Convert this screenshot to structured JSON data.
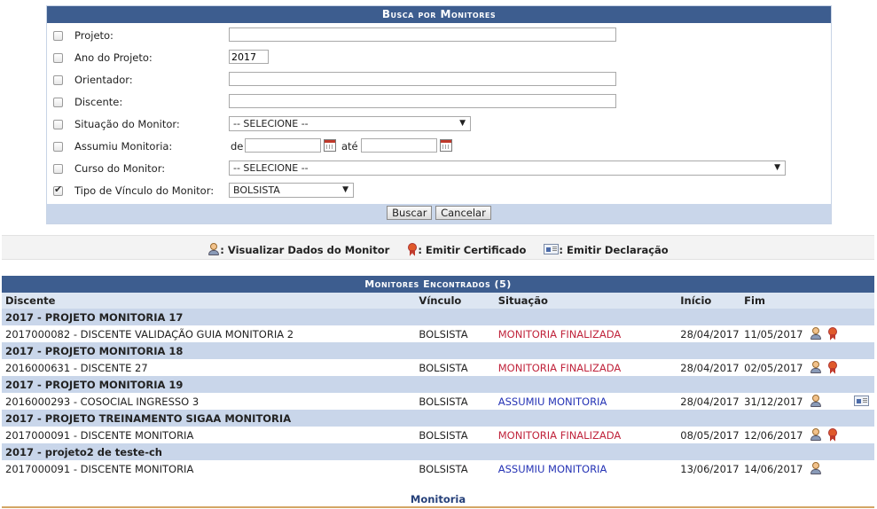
{
  "search": {
    "title": "Busca por Monitores",
    "fields": {
      "projeto": {
        "label": "Projeto:",
        "value": ""
      },
      "ano": {
        "label": "Ano do Projeto:",
        "value": "2017"
      },
      "orientador": {
        "label": "Orientador:",
        "value": ""
      },
      "discente": {
        "label": "Discente:",
        "value": ""
      },
      "situacao": {
        "label": "Situação do Monitor:",
        "value": "-- SELECIONE --"
      },
      "assumiu": {
        "label": "Assumiu Monitoria:",
        "de": "de",
        "ate": "até",
        "from": "",
        "to": ""
      },
      "curso": {
        "label": "Curso do Monitor:",
        "value": "-- SELECIONE --"
      },
      "vinculo": {
        "label": "Tipo de Vínculo do Monitor:",
        "value": "BOLSISTA"
      }
    },
    "buttons": {
      "buscar": "Buscar",
      "cancelar": "Cancelar"
    }
  },
  "legend": {
    "visualizar": ": Visualizar Dados do Monitor",
    "certificado": ": Emitir Certificado",
    "declaracao": ": Emitir Declaração"
  },
  "results": {
    "title": "Monitores Encontrados (5)",
    "headers": {
      "discente": "Discente",
      "vinculo": "Vínculo",
      "situacao": "Situação",
      "inicio": "Início",
      "fim": "Fim"
    },
    "groups": [
      {
        "title": "2017 - PROJETO MONITORIA 17",
        "row": {
          "discente": "2017000082 - DISCENTE VALIDAÇÃO GUIA MONITORIA 2",
          "vinculo": "BOLSISTA",
          "situacao": "MONITORIA FINALIZADA",
          "inicio": "28/04/2017",
          "fim": "11/05/2017"
        }
      },
      {
        "title": "2017 - PROJETO MONITORIA 18",
        "row": {
          "discente": "2016000631 - DISCENTE 27",
          "vinculo": "BOLSISTA",
          "situacao": "MONITORIA FINALIZADA",
          "inicio": "28/04/2017",
          "fim": "02/05/2017"
        }
      },
      {
        "title": "2017 - PROJETO MONITORIA 19",
        "row": {
          "discente": "2016000293 - COSOCIAL INGRESSO 3",
          "vinculo": "BOLSISTA",
          "situacao": "ASSUMIU MONITORIA",
          "inicio": "28/04/2017",
          "fim": "31/12/2017"
        }
      },
      {
        "title": "2017 - PROJETO TREINAMENTO SIGAA MONITORIA",
        "row": {
          "discente": "2017000091 - DISCENTE MONITORIA",
          "vinculo": "BOLSISTA",
          "situacao": "MONITORIA FINALIZADA",
          "inicio": "08/05/2017",
          "fim": "12/06/2017"
        }
      },
      {
        "title": "2017 - projeto2 de teste-ch",
        "row": {
          "discente": "2017000091 - DISCENTE MONITORIA",
          "vinculo": "BOLSISTA",
          "situacao": "ASSUMIU MONITORIA",
          "inicio": "13/06/2017",
          "fim": "14/06/2017"
        }
      }
    ]
  },
  "footer": {
    "label": "Monitoria"
  },
  "colors": {
    "header": "#3d5d8f",
    "group": "#c9d6ea",
    "finalizada": "#c0243c",
    "assumiu": "#2533b5",
    "footer_line": "#d3a665"
  },
  "icons": {
    "visualizar": "user-view-icon",
    "certificado": "certificate-ribbon-icon",
    "declaracao": "declaration-card-icon"
  }
}
